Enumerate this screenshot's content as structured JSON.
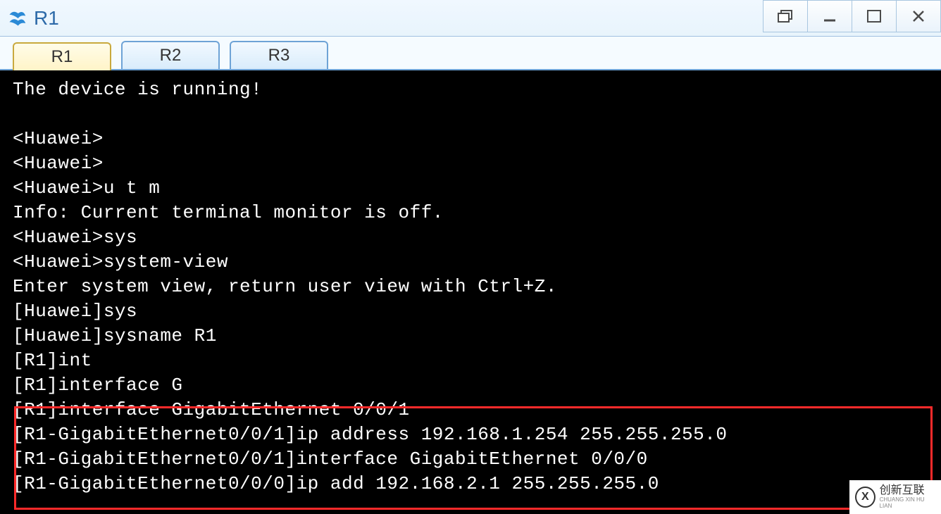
{
  "window": {
    "title": "R1"
  },
  "tabs": [
    {
      "label": "R1",
      "active": true
    },
    {
      "label": "R2",
      "active": false
    },
    {
      "label": "R3",
      "active": false
    }
  ],
  "terminal": {
    "lines": [
      "The device is running!",
      "",
      "<Huawei>",
      "<Huawei>",
      "<Huawei>u t m",
      "Info: Current terminal monitor is off.",
      "<Huawei>sys",
      "<Huawei>system-view",
      "Enter system view, return user view with Ctrl+Z.",
      "[Huawei]sys",
      "[Huawei]sysname R1",
      "[R1]int",
      "[R1]interface G",
      "[R1]interface GigabitEthernet 0/0/1",
      "[R1-GigabitEthernet0/0/1]ip address 192.168.1.254 255.255.255.0",
      "[R1-GigabitEthernet0/0/1]interface GigabitEthernet 0/0/0",
      "[R1-GigabitEthernet0/0/0]ip add 192.168.2.1 255.255.255.0"
    ]
  },
  "watermark": {
    "logo_letter": "X",
    "text": "创新互联",
    "sub": "CHUANG XIN HU LIAN"
  },
  "icons": {
    "app": "ensp-icon",
    "restore": "restore-icon",
    "minimize": "minimize-icon",
    "maximize": "maximize-icon",
    "close": "close-icon"
  }
}
